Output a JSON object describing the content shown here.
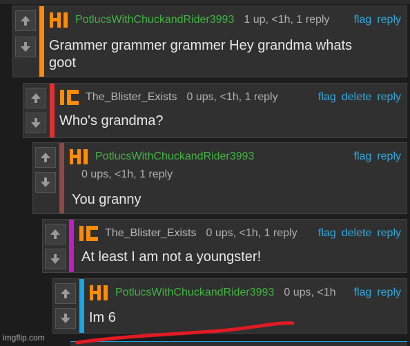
{
  "comments": [
    {
      "user": "PotlucsWithChuckandRider3993",
      "meta": "1 up, <1h, 1 reply",
      "actions": [
        "flag",
        "reply"
      ],
      "body_lines": [
        "Grammer grammer grammer Hey grandma whats",
        "goot"
      ],
      "bar_color": "#ff8c00",
      "badge": "HI"
    },
    {
      "user": "The_Blister_Exists",
      "meta": "0 ups, <1h, 1 reply",
      "actions": [
        "flag",
        "delete",
        "reply"
      ],
      "body_lines": [
        "Who's grandma?"
      ],
      "bar_color": "#e03030",
      "badge": "IC"
    },
    {
      "user": "PotlucsWithChuckandRider3993",
      "meta": "0 ups, <1h, 1 reply",
      "actions": [
        "flag",
        "reply"
      ],
      "body_lines": [
        "You granny"
      ],
      "bar_color": "#8b4a44",
      "badge": "HI"
    },
    {
      "user": "The_Blister_Exists",
      "meta": "0 ups, <1h, 1 reply",
      "actions": [
        "flag",
        "delete",
        "reply"
      ],
      "body_lines": [
        "At least I am not a youngster!"
      ],
      "bar_color": "#c51bc5",
      "badge": "IC"
    },
    {
      "user": "PotlucsWithChuckandRider3993",
      "meta": "0 ups, <1h",
      "actions": [
        "flag",
        "reply"
      ],
      "body_lines": [
        "Im 6"
      ],
      "bar_color": "#1aa7e8",
      "badge": "HI"
    }
  ],
  "watermark": "imgflip.com",
  "colors": {
    "username": "#43b343",
    "link": "#31a9de",
    "badge": "#ff8c00",
    "annotation": "#e01b24"
  },
  "icons": {
    "upvote": "arrow-up-icon",
    "downvote": "arrow-down-icon"
  }
}
